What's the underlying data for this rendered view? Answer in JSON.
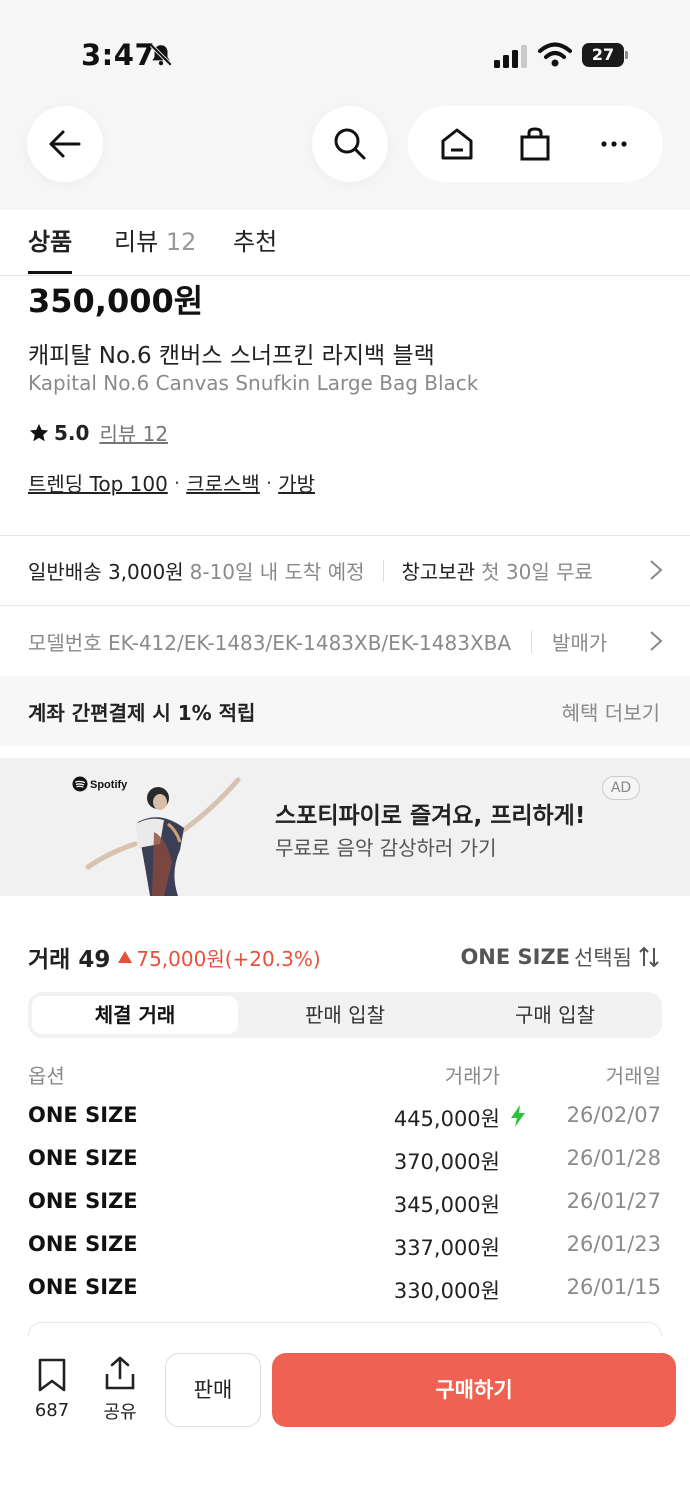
{
  "status_bar": {
    "time": "3:47",
    "battery": "27"
  },
  "tabs": [
    {
      "label": "상품",
      "count": ""
    },
    {
      "label": "리뷰",
      "count": "12"
    },
    {
      "label": "추천",
      "count": ""
    }
  ],
  "product": {
    "price": "350,000원",
    "name_ko": "캐피탈 No.6 캔버스 스너프킨 라지백 블랙",
    "name_en": "Kapital No.6 Canvas Snufkin Large Bag Black",
    "rating": "5.0",
    "review_link": "리뷰 12",
    "categories": [
      "트렌딩 Top 100",
      "크로스백",
      "가방"
    ],
    "category_sep": "·"
  },
  "shipping": {
    "type": "일반배송 3,000원",
    "eta": "8-10일 내 도착 예정",
    "storage": "창고보관",
    "storage_note": "첫 30일 무료"
  },
  "model": {
    "label": "모델번호 EK-412/EK-1483/EK-1483XB/EK-1483XBA",
    "release": "발매가"
  },
  "benefit": {
    "text": "계좌 간편결제 시 1% 적립",
    "more": "혜택 더보기"
  },
  "ad": {
    "brand": "Spotify",
    "title": "스포티파이로 즐겨요, 프리하게!",
    "subtitle": "무료로 음악 감상하러 가기",
    "badge": "AD"
  },
  "trades": {
    "label": "거래 49",
    "change": "75,000원(+20.3%)",
    "size_selected": "ONE SIZE",
    "size_suffix": "선택됨",
    "segments": [
      "체결 거래",
      "판매 입찰",
      "구매 입찰"
    ],
    "columns": [
      "옵션",
      "거래가",
      "거래일"
    ],
    "rows": [
      {
        "option": "ONE SIZE",
        "price": "445,000원",
        "date": "26/02/07",
        "fast": true
      },
      {
        "option": "ONE SIZE",
        "price": "370,000원",
        "date": "26/01/28",
        "fast": false
      },
      {
        "option": "ONE SIZE",
        "price": "345,000원",
        "date": "26/01/27",
        "fast": false
      },
      {
        "option": "ONE SIZE",
        "price": "337,000원",
        "date": "26/01/23",
        "fast": false
      },
      {
        "option": "ONE SIZE",
        "price": "330,000원",
        "date": "26/01/15",
        "fast": false
      }
    ]
  },
  "bottom_bar": {
    "bookmark_count": "687",
    "share_label": "공유",
    "sell_label": "판매",
    "buy_label": "구매하기"
  },
  "colors": {
    "accent": "#ef6253",
    "rise": "#e8503c",
    "fast_bolt": "#2fbf3a"
  }
}
